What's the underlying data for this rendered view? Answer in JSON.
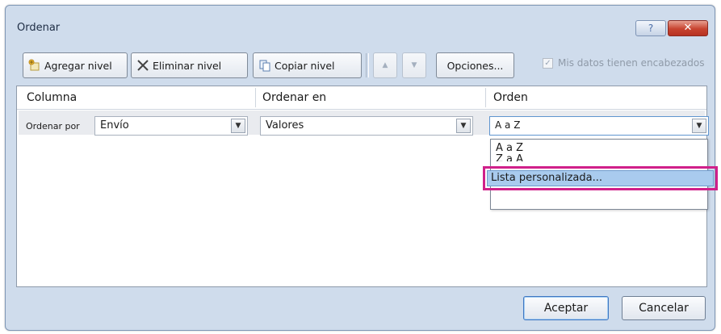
{
  "dialog": {
    "title": "Ordenar",
    "help_glyph": "?",
    "close_glyph": "✕"
  },
  "toolbar": {
    "add_level": "Agregar nivel",
    "delete_level": "Eliminar nivel",
    "copy_level": "Copiar nivel",
    "move_up_glyph": "▲",
    "move_down_glyph": "▼",
    "options": "Opciones...",
    "headers_checkbox": "Mis datos tienen encabezados",
    "headers_checked": true
  },
  "grid": {
    "headers": {
      "column": "Columna",
      "sort_on": "Ordenar en",
      "order": "Orden"
    },
    "row": {
      "label": "Ordenar por",
      "column_value": "Envío",
      "sort_on_value": "Valores",
      "order_value": "A a Z"
    }
  },
  "order_dropdown": {
    "options": [
      "A a Z",
      "Z a A",
      "Lista personalizada..."
    ],
    "highlighted_index": 2,
    "highlight_color": "#d0208a"
  },
  "footer": {
    "ok": "Aceptar",
    "cancel": "Cancelar"
  },
  "icons": {
    "add": "add-level-icon",
    "delete": "delete-level-icon",
    "copy": "copy-level-icon",
    "dropdown": "chevron-down-icon"
  }
}
